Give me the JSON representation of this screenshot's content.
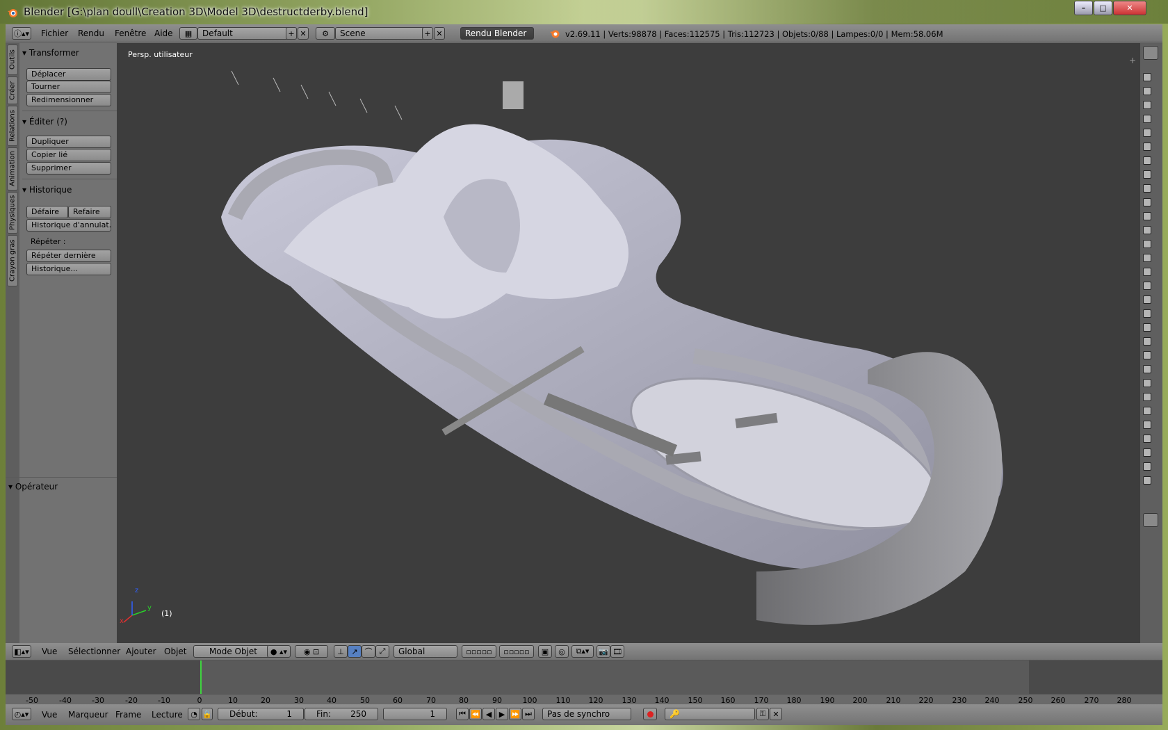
{
  "window": {
    "title": "Blender [G:\\plan doull\\Creation 3D\\Model 3D\\destructderby.blend]",
    "controls": {
      "minimize": "–",
      "maximize": "□",
      "close": "✕"
    }
  },
  "info_header": {
    "menus": [
      "Fichier",
      "Rendu",
      "Fenêtre",
      "Aide"
    ],
    "layout": "Default",
    "scene": "Scene",
    "engine": "Rendu Blender",
    "stats": "v2.69.11 | Verts:98878 | Faces:112575 | Tris:112723 | Objets:0/88 | Lampes:0/0 | Mem:58.06M"
  },
  "vertical_tabs": [
    "Outils",
    "Créer",
    "Relations",
    "Animation",
    "Physiques",
    "Crayon gras"
  ],
  "toolshelf": {
    "transform": {
      "title": "Transformer",
      "buttons": [
        "Déplacer",
        "Tourner",
        "Redimensionner"
      ]
    },
    "edit": {
      "title": "Éditer (?)",
      "buttons": [
        "Dupliquer",
        "Copier lié",
        "Supprimer"
      ]
    },
    "history": {
      "title": "Historique",
      "undo": "Défaire",
      "redo": "Refaire",
      "undo_history": "Historique d'annulat...",
      "repeat_label": "Répéter  :",
      "repeat_last": "Répéter dernière",
      "repeat_history": "Historique..."
    },
    "operator": {
      "title": "Opérateur"
    }
  },
  "viewport": {
    "view_label": "Persp. utilisateur",
    "frame_label": "(1)",
    "axes": {
      "x": "x",
      "y": "y",
      "z": "z"
    }
  },
  "view3d_header": {
    "menus": [
      "Vue",
      "Sélectionner",
      "Ajouter",
      "Objet"
    ],
    "mode": "Mode Objet",
    "orientation": "Global"
  },
  "timeline": {
    "ticks": [
      "-50",
      "-40",
      "-30",
      "-20",
      "-10",
      "0",
      "10",
      "20",
      "30",
      "40",
      "50",
      "60",
      "70",
      "80",
      "90",
      "100",
      "110",
      "120",
      "130",
      "140",
      "150",
      "160",
      "170",
      "180",
      "190",
      "200",
      "210",
      "220",
      "230",
      "240",
      "250",
      "260",
      "270",
      "280"
    ],
    "menus": [
      "Vue",
      "Marqueur",
      "Frame",
      "Lecture"
    ],
    "start_label": "Début:",
    "start_value": "1",
    "end_label": "Fin:",
    "end_value": "250",
    "current_frame": "1",
    "sync": "Pas de synchro"
  },
  "colors": {
    "viewport_bg": "#3d3d3d",
    "panel_bg": "#727272",
    "current_frame": "#3fd43f"
  }
}
